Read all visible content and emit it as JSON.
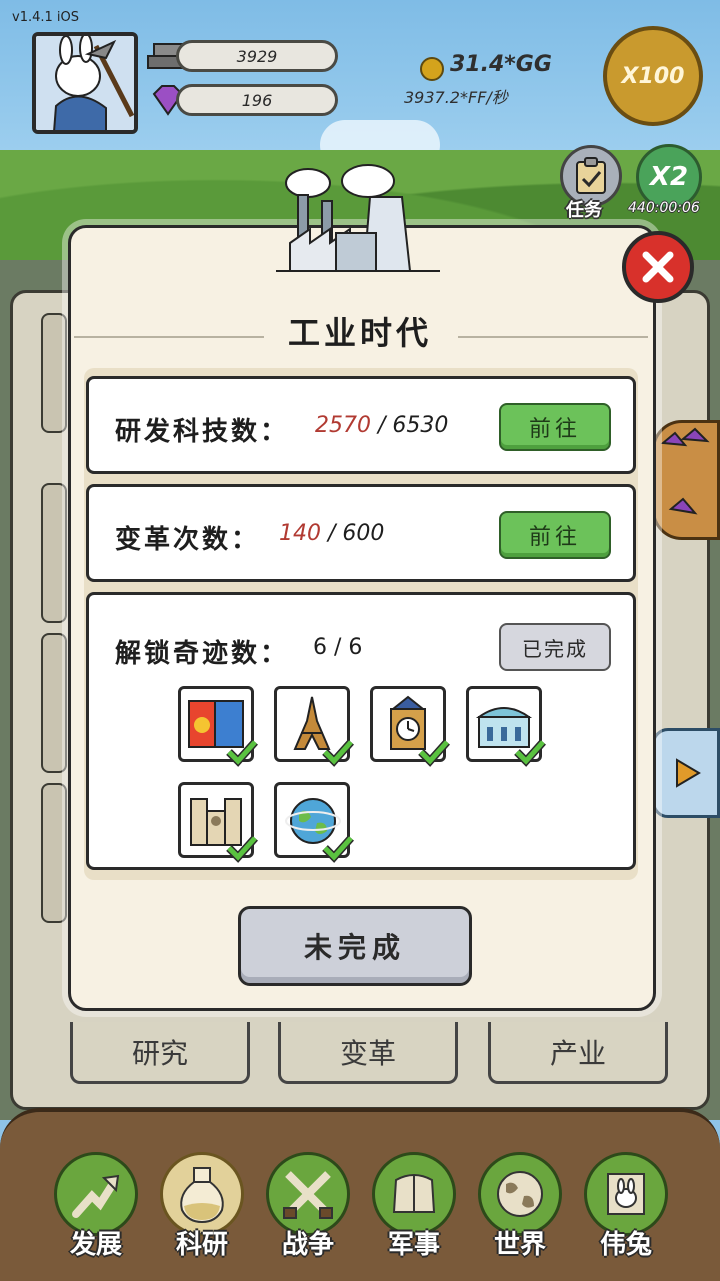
{
  "version": "v1.4.1 iOS",
  "resources": {
    "iron": "3929",
    "gem": "196"
  },
  "currency": {
    "gold": "31.4*GG",
    "rate": "3937.2*FF/秒"
  },
  "boost": {
    "x100": "X100",
    "x2": "X2",
    "timer": "440:00:06",
    "task_label": "任务"
  },
  "modal": {
    "title": "工业时代",
    "rows": [
      {
        "label": "研发科技数：",
        "current": "2570",
        "sep": " / ",
        "total": "6530",
        "button": "前往"
      },
      {
        "label": "变革次数：",
        "current": "140",
        "sep": " / ",
        "total": "600",
        "button": "前往"
      },
      {
        "label": "解锁奇迹数：",
        "current": "6",
        "sep": " / ",
        "total": "6",
        "button": "已完成"
      }
    ],
    "wonders": [
      "colosseum-posters",
      "eiffel-tower",
      "big-ben",
      "palace",
      "notre-dame",
      "globe"
    ],
    "bottom_button": "未完成"
  },
  "subtabs": [
    "研究",
    "变革",
    "产业"
  ],
  "nav": [
    {
      "label": "发展",
      "icon": "arrow-up-icon"
    },
    {
      "label": "科研",
      "icon": "flask-icon"
    },
    {
      "label": "战争",
      "icon": "crossed-swords-icon"
    },
    {
      "label": "军事",
      "icon": "armor-icon"
    },
    {
      "label": "世界",
      "icon": "globe-icon"
    },
    {
      "label": "伟兔",
      "icon": "rabbit-portrait-icon"
    }
  ],
  "nav_active": "科研",
  "colors": {
    "accent_green": "#6cc25a",
    "close_red": "#d8312b",
    "value_red": "#b13a32",
    "gold": "#c99a2e"
  }
}
